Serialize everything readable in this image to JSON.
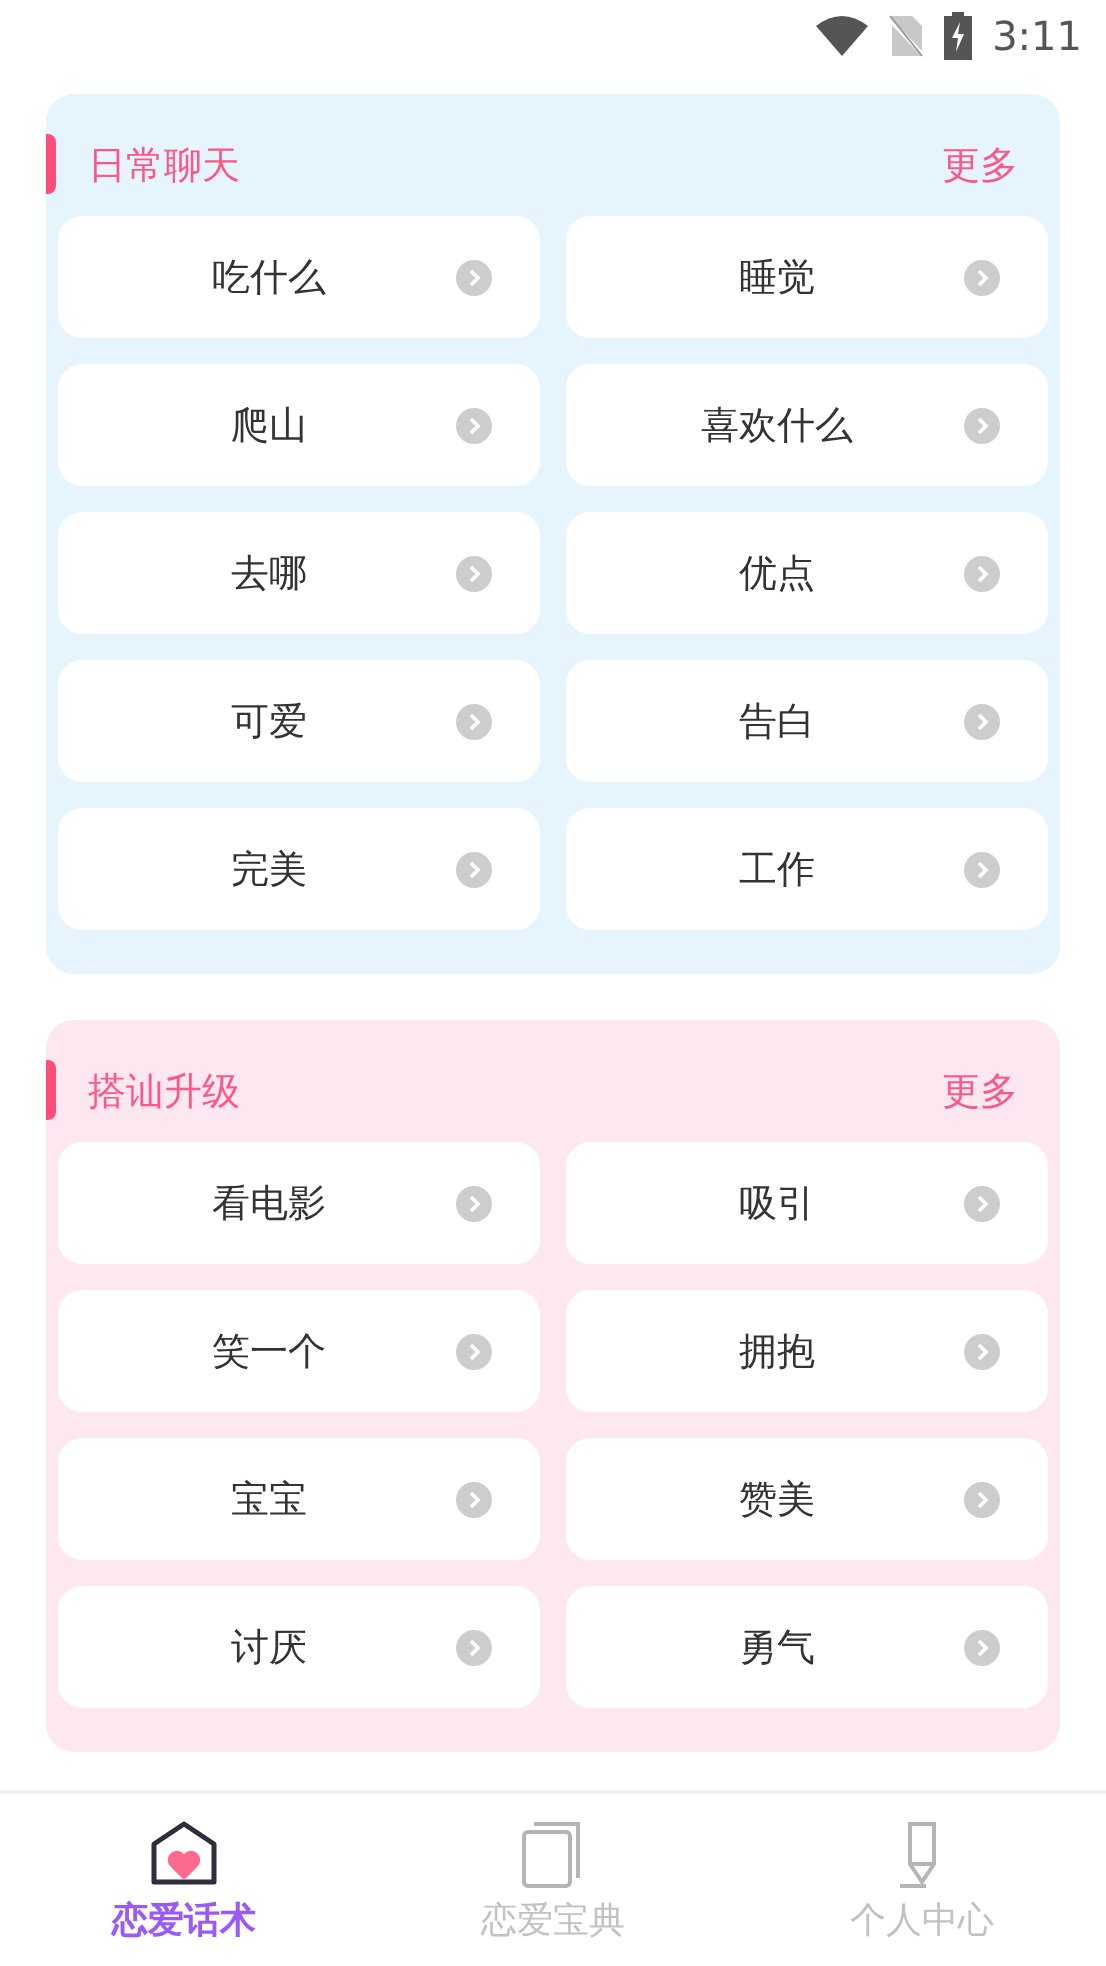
{
  "status_bar": {
    "time": "3:11"
  },
  "sections": [
    {
      "title": "日常聊天",
      "more": "更多",
      "color": "#e6f4fe",
      "items": [
        "吃什么",
        "睡觉",
        "爬山",
        "喜欢什么",
        "去哪",
        "优点",
        "可爱",
        "告白",
        "完美",
        "工作"
      ]
    },
    {
      "title": "搭讪升级",
      "more": "更多",
      "color": "#fde7f1",
      "items": [
        "看电影",
        "吸引",
        "笑一个",
        "拥抱",
        "宝宝",
        "赞美",
        "讨厌",
        "勇气"
      ]
    }
  ],
  "nav": [
    {
      "label": "恋爱话术",
      "kind": "home",
      "selected": true
    },
    {
      "label": "恋爱宝典",
      "kind": "book",
      "selected": false
    },
    {
      "label": "个人中心",
      "kind": "pen",
      "selected": false
    }
  ]
}
